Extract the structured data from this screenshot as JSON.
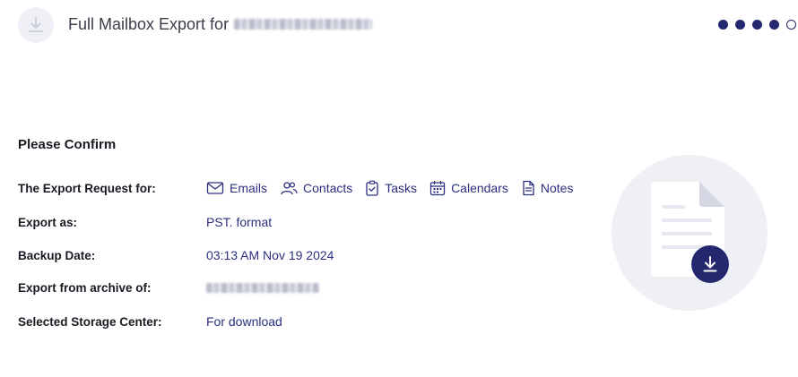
{
  "header": {
    "title": "Full Mailbox Export for",
    "icon": "download-icon",
    "steps": {
      "total": 5,
      "completed": 4
    }
  },
  "confirm": {
    "title": "Please Confirm",
    "rows": {
      "request": {
        "label": "The Export Request for:"
      },
      "format": {
        "label": "Export as:",
        "value": "PST. format"
      },
      "backup_date": {
        "label": "Backup Date:",
        "value": "03:13 AM Nov 19 2024"
      },
      "archive": {
        "label": "Export from archive of:"
      },
      "storage": {
        "label": "Selected Storage Center:",
        "value": "For download"
      }
    },
    "types": [
      {
        "label": "Emails",
        "icon": "mail-icon"
      },
      {
        "label": "Contacts",
        "icon": "contacts-icon"
      },
      {
        "label": "Tasks",
        "icon": "clipboard-check-icon"
      },
      {
        "label": "Calendars",
        "icon": "calendar-icon"
      },
      {
        "label": "Notes",
        "icon": "note-icon"
      }
    ]
  },
  "colors": {
    "accent": "#24286e",
    "link": "#2b3080",
    "illustration_bg": "#eef0f6"
  }
}
